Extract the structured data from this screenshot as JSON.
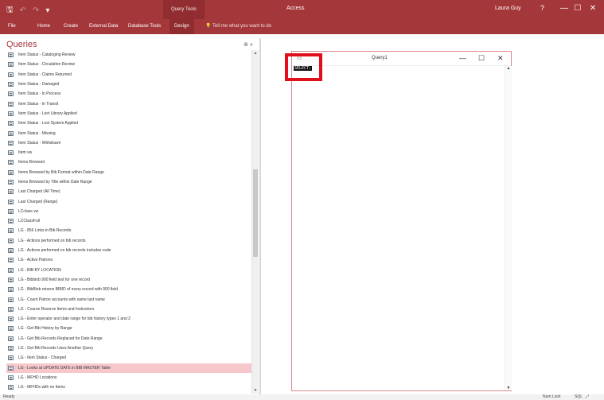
{
  "titlebar": {
    "qat_save": "🖫",
    "qat_undo": "↶",
    "qat_redo": "↷",
    "qat_customize": "▾",
    "context_tab": "Query Tools",
    "app_title": "Access",
    "user": "Laura Guy",
    "help": "?",
    "minimize": "—",
    "maximize": "☐",
    "close": "✕"
  },
  "ribbon": {
    "tabs": [
      "File",
      "Home",
      "Create",
      "External Data",
      "Database Tools",
      "Design"
    ],
    "tell_me": "Tell me what you want to do",
    "tell_me_icon": "lightbulb-icon"
  },
  "nav": {
    "header": "Queries",
    "search_icon": "⊚",
    "collapse_icon": "«",
    "items": [
      "Item Status - Cataloging Review",
      "Item Status - Circulation Review",
      "Item Status - Claims Returned",
      "Item Status - Damaged",
      "Item Status - In Process",
      "Item Status - In Transit",
      "Item Status - Lost Library Applied",
      "Item Status - Lost System Applied",
      "Item Status - Missing",
      "Item Status - Withdrawn",
      "Item vw",
      "Items Browsed",
      "Items Browsed by Bib Format within Date Range",
      "Items Browsed by Title within Date Range",
      "Last Charged (All Time)",
      "Last Charged (Range)",
      "LCclass vw",
      "LCClassFull",
      "LG - 856 Links in Bib Records",
      "LG - Actions performed on bib records",
      "LG - Actions performed on bib records includes code",
      "LG - Active Patrons",
      "LG - BIB BY LOCATION",
      "LG - Bibblob 900 field test for one record",
      "LG - BibBlob returns BIBID of every record with 900 field",
      "LG - Count Patron accounts with same last name",
      "LG - Course Reserve Items and Instructors",
      "LG - Enter operator and date range for bib history types 1 and 2",
      "LG - Get Bib History by Range",
      "LG - Get Bib Records Replaced for Date Range",
      "LG - Get Bib Records Uses Another Query",
      "LG - Item Status - Charged",
      "LG - Looks at UPDATE DATE in BIB MASTER Table",
      "LG - MFHD Locations",
      "LG - MFHDs with no Items"
    ],
    "selected_index": 32
  },
  "query_window": {
    "title": "Query1",
    "minimize": "—",
    "maximize": "☐",
    "close": "✕",
    "sql_text": "SELECT;"
  },
  "status": {
    "ready": "Ready",
    "num_lock": "Num Lock",
    "sql_view_icon": "SQL",
    "design_view_icon": "⤢"
  }
}
